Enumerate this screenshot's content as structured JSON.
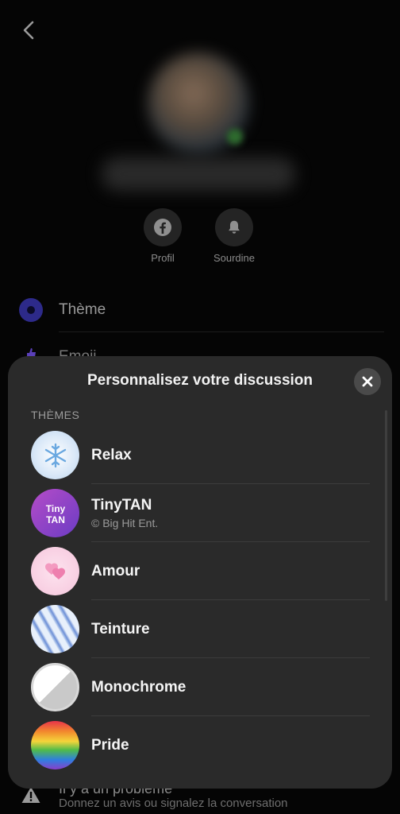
{
  "profile": {
    "actions": [
      {
        "label": "Profil",
        "icon": "facebook-icon"
      },
      {
        "label": "Sourdine",
        "icon": "bell-icon"
      }
    ]
  },
  "settings": {
    "theme_label": "Thème",
    "emoji_label": "Emoji",
    "problem_title": "Il y a un problème",
    "problem_subtitle": "Donnez un avis ou signalez la conversation"
  },
  "sheet": {
    "title": "Personnalisez votre discussion",
    "section_label": "THÈMES",
    "themes": [
      {
        "name": "Relax",
        "subtitle": ""
      },
      {
        "name": "TinyTAN",
        "subtitle": "© Big Hit Ent."
      },
      {
        "name": "Amour",
        "subtitle": ""
      },
      {
        "name": "Teinture",
        "subtitle": ""
      },
      {
        "name": "Monochrome",
        "subtitle": ""
      },
      {
        "name": "Pride",
        "subtitle": ""
      }
    ],
    "tinytan_logo_text": "TinyTAN"
  },
  "colors": {
    "sheet_bg": "#2a2a2a",
    "theme_accent": "#2d2a8a"
  }
}
